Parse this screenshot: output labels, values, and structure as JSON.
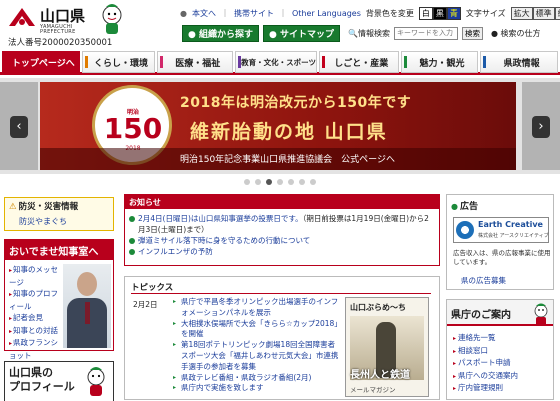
{
  "header": {
    "logo_text": "山口県",
    "logo_sub1": "YAMAGUCHI",
    "logo_sub2": "PREFECTURE",
    "corp_number": "法人番号2000020350001"
  },
  "util": {
    "skip": "本文へ",
    "mobile": "携帯サイト",
    "languages": "Other Languages",
    "bg_label": "背景色を変更",
    "bg_white": "白",
    "bg_black": "黒",
    "bg_blue": "青",
    "fontsize_label": "文字サイズ",
    "font_large": "拡大",
    "font_std": "標準",
    "font_small": "縮小"
  },
  "row2": {
    "org_button": "組織から探す",
    "sitemap_button": "サイトマップ",
    "search_label": "情報検索",
    "search_placeholder": "キーワードを入力",
    "search_button": "検索",
    "howto": "検索の仕方"
  },
  "nav": {
    "items": [
      {
        "label": "トップページへ"
      },
      {
        "label": "くらし・環境"
      },
      {
        "label": "医療・福祉"
      },
      {
        "label": "教育・文化・スポーツ"
      },
      {
        "label": "しごと・産業"
      },
      {
        "label": "魅力・観光"
      },
      {
        "label": "県政情報"
      }
    ],
    "colors": [
      "#b8001c",
      "#e07b00",
      "#d1286a",
      "#6a3aa0",
      "#c2001c",
      "#1c8a3a",
      "#1c5aa8"
    ]
  },
  "banner": {
    "seal_top": "明治",
    "seal_number": "150",
    "seal_year": "2018",
    "line1": "2018年は明治改元から150年です",
    "line2": "維新胎動の地 山口県",
    "line3": "明治150年記念事業山口県推進協議会　公式ページへ",
    "arrow_left": "‹",
    "arrow_right": "›",
    "dot_count": 7,
    "active_dot": 2
  },
  "disaster": {
    "title": "防災・災害情報",
    "link": "防災やまぐち"
  },
  "governor": {
    "title": "おいでませ知事室へ",
    "links": [
      "知事のメッセージ",
      "知事のプロフィール",
      "記者会見",
      "知事との対話",
      "県政フランショット"
    ]
  },
  "profile": {
    "title_line1": "山口県の",
    "title_line2": "プロフィール"
  },
  "notice": {
    "title": "お知らせ",
    "items": [
      {
        "text": "2月4日(日曜日)は山口県知事選挙の投票日です。",
        "sub": "（期日前投票は1月19日(金曜日)から2月3日(土曜日)まで）"
      },
      {
        "text": "弾道ミサイル落下時に身を守るための行動について",
        "sub": ""
      },
      {
        "text": "インフルエンザの予防",
        "sub": ""
      }
    ]
  },
  "topics": {
    "title": "トピックス",
    "date": "2月2日",
    "items": [
      "県庁で平昌冬季オリンピック出場選手のインフォメーションパネルを展示",
      "大相撲水俣場所で大会「きらら☆カップ2018」を開催",
      "第18回ポテトリンピック劇場18回全国障害者スポーツ大会「福井しあわせ元気大会」市連携手選手の参加者を募集",
      "県政テレビ番組・県政ラジオ番組(2月)",
      "県庁内で実施を致します"
    ],
    "image_title": "山口ぶらめ～ち",
    "image_caption": "長州人と鉄道",
    "image_sub": "メールマガジン"
  },
  "ad": {
    "title": "広告",
    "banner_title": "Earth Creative",
    "banner_sub": "株式会社 アースクリエイティブ",
    "desc": "広告収入は、県の広報事業に使用しています。",
    "link": "県の広告募集"
  },
  "guide": {
    "title": "県庁のご案内",
    "items": [
      "連絡先一覧",
      "相談窓口",
      "パスポート申請",
      "県庁への交通案内",
      "庁内管理規則"
    ]
  }
}
